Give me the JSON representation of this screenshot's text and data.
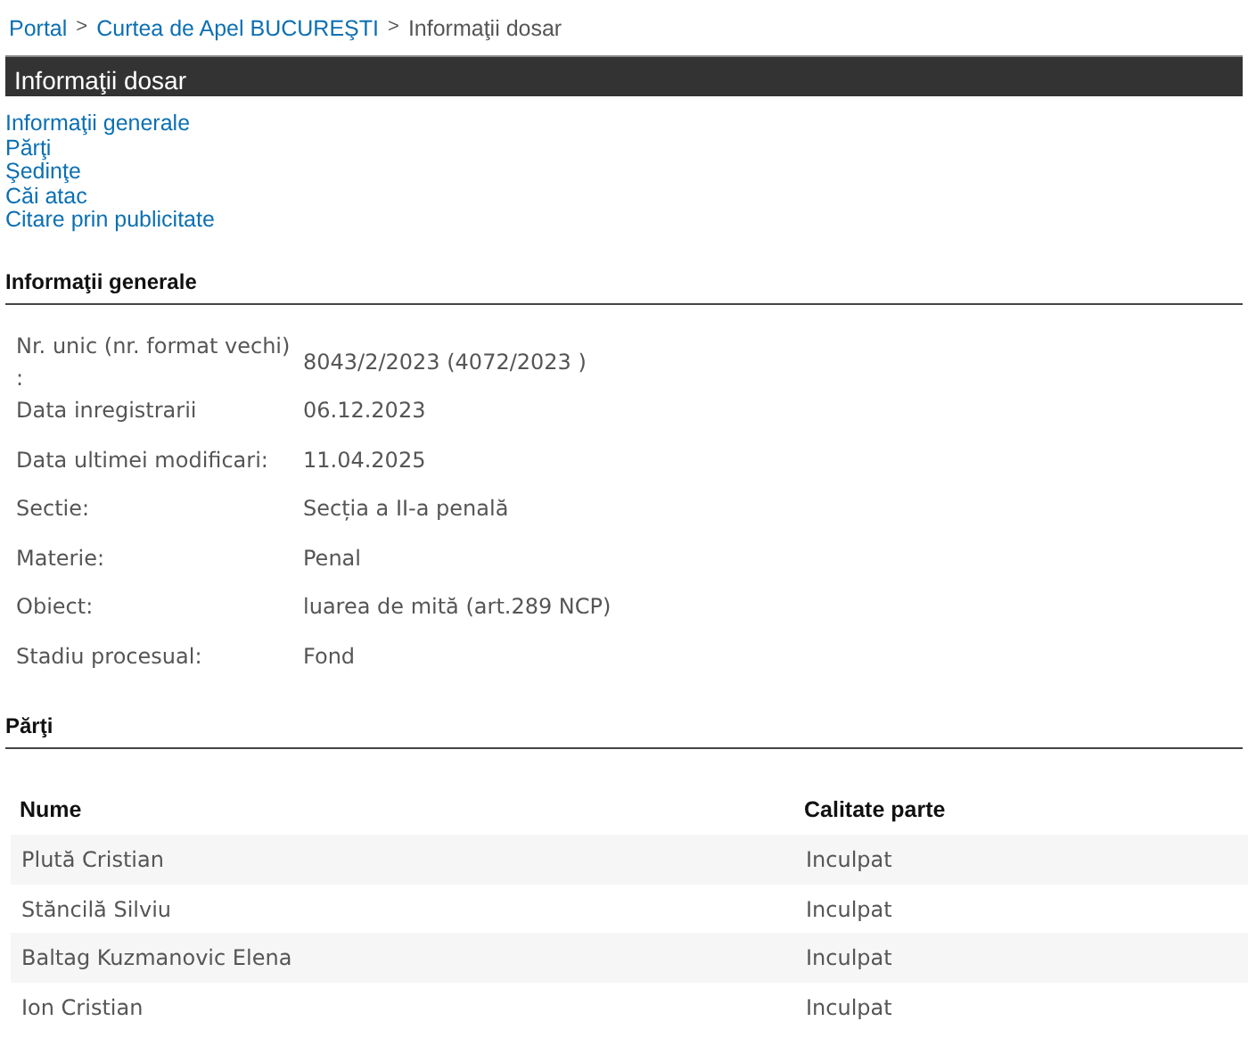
{
  "breadcrumb": [
    {
      "kind": "link",
      "label": "Portal"
    },
    {
      "kind": "separator",
      "label": ">"
    },
    {
      "kind": "link",
      "label": "Curtea de Apel BUCUREŞTI"
    },
    {
      "kind": "separator",
      "label": ">"
    },
    {
      "kind": "current",
      "label": "Informaţii dosar"
    }
  ],
  "title_bar": {
    "title": "Informaţii dosar"
  },
  "section_links": [
    "Informaţii generale",
    "Părţi",
    "Şedinţe",
    "Căi atac",
    "Citare prin publicitate"
  ],
  "general_info": {
    "heading": "Informaţii generale",
    "fields": [
      {
        "label": "Nr. unic (nr. format vechi) :",
        "value": "8043/2/2023 (4072/2023 )"
      },
      {
        "label": "Data inregistrarii",
        "value": "06.12.2023"
      },
      {
        "label": "Data ultimei modificari:",
        "value": "11.04.2025"
      },
      {
        "label": "Sectie:",
        "value": "Secția a II-a penală"
      },
      {
        "label": "Materie:",
        "value": "Penal"
      },
      {
        "label": "Obiect:",
        "value": "luarea de mită (art.289 NCP)"
      },
      {
        "label": "Stadiu procesual:",
        "value": "Fond"
      }
    ]
  },
  "parties": {
    "heading": "Părţi",
    "columns": [
      "Nume",
      "Calitate parte"
    ],
    "rows": [
      [
        "Plută Cristian",
        "Inculpat"
      ],
      [
        "Stăncilă Silviu",
        "Inculpat"
      ],
      [
        "Baltag Kuzmanovic Elena",
        "Inculpat"
      ],
      [
        "Ion Cristian",
        "Inculpat"
      ]
    ]
  }
}
